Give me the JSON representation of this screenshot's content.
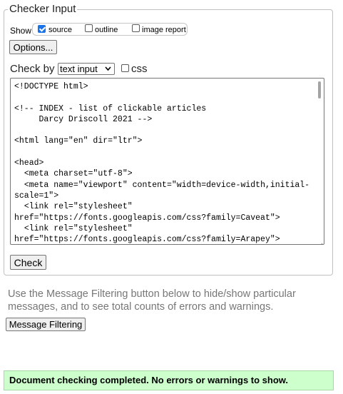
{
  "checker_input": {
    "legend": "Checker Input",
    "show_label": "Show",
    "show_options": [
      {
        "label": "source",
        "checked": true
      },
      {
        "label": "outline",
        "checked": false
      },
      {
        "label": "image report",
        "checked": false
      }
    ],
    "options_button": "Options...",
    "check_by_label": "Check by",
    "check_by_select": "text input",
    "css_label": "css",
    "css_checked": false,
    "source_text": "<!DOCTYPE html>\n\n<!-- INDEX - list of clickable articles\n     Darcy Driscoll 2021 -->\n\n<html lang=\"en\" dir=\"ltr\">\n\n<head>\n  <meta charset=\"utf-8\">\n  <meta name=\"viewport\" content=\"width=device-width,initial-scale=1\">\n  <link rel=\"stylesheet\"\nhref=\"https://fonts.googleapis.com/css?family=Caveat\">\n  <link rel=\"stylesheet\"\nhref=\"https://fonts.googleapis.com/css?family=Arapey\">",
    "check_button": "Check"
  },
  "message_filtering": {
    "info_text": "Use the Message Filtering button below to hide/show particular messages, and to see total counts of errors and warnings.",
    "button": "Message Filtering"
  },
  "status": {
    "text": "Document checking completed. No errors or warnings to show.",
    "color": "#ccffcc"
  },
  "icons": {
    "select_chevron": "chevron-down-icon",
    "textarea_resize": "resize-grip-icon"
  }
}
